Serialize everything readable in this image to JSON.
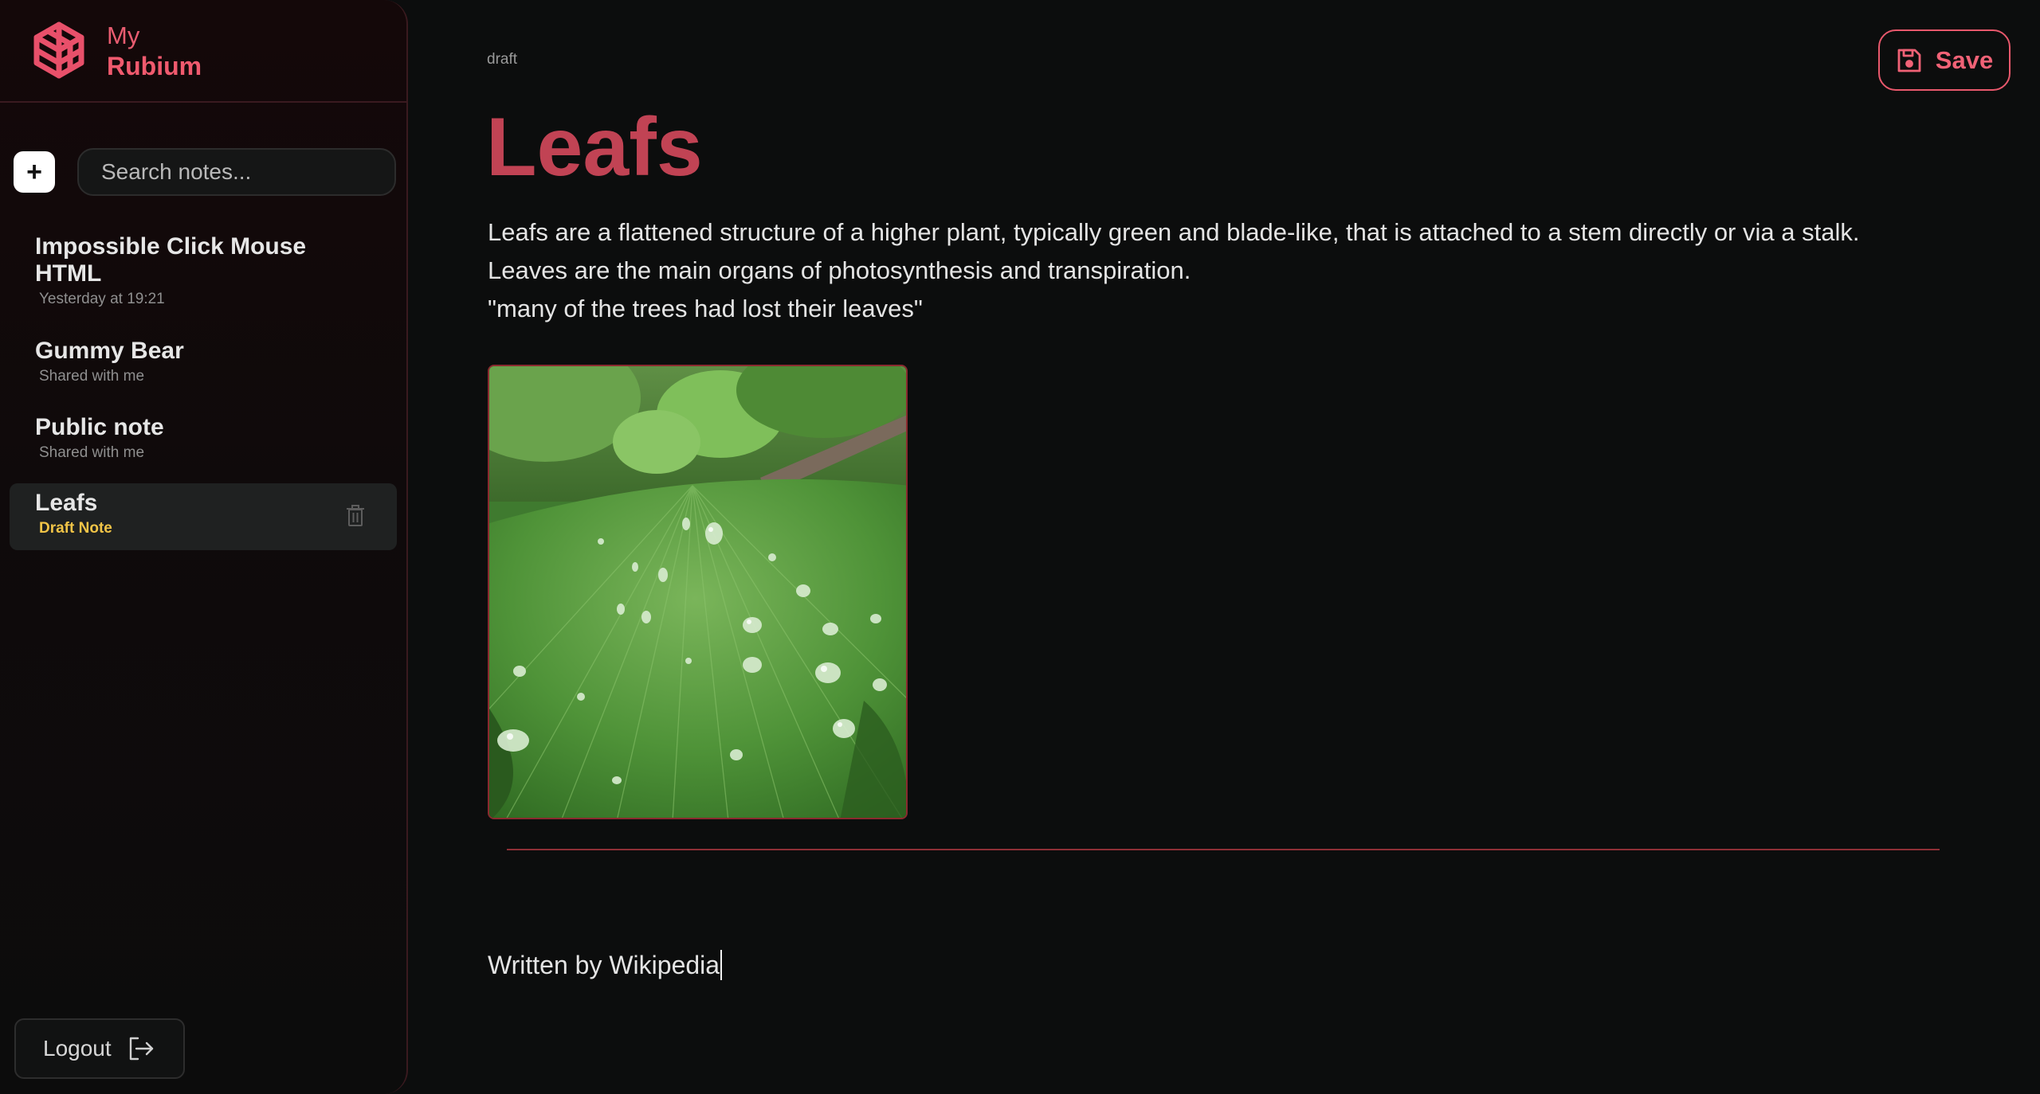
{
  "brand": {
    "line1": "My",
    "line2": "Rubium",
    "logo_icon": "rubium-logo-icon",
    "accent_color": "#f05a6e"
  },
  "sidebar": {
    "add_label": "+",
    "search_placeholder": "Search notes...",
    "search_value": "",
    "notes": [
      {
        "title": "Impossible Click Mouse HTML",
        "subtitle": "Yesterday at 19:21"
      },
      {
        "title": "Gummy Bear",
        "subtitle": "Shared with me"
      },
      {
        "title": "Public note",
        "subtitle": "Shared with me"
      },
      {
        "title": "Leafs",
        "subtitle": "Draft Note",
        "active": true
      }
    ],
    "logout_label": "Logout"
  },
  "editor": {
    "status": "draft",
    "save_label": "Save",
    "title": "Leafs",
    "paragraphs": [
      "Leafs are a flattened structure of a higher plant, typically green and blade-like, that is attached to a stem directly or via a stalk.",
      "Leaves are the main organs of photosynthesis and transpiration.",
      "\"many of the trees had lost their leaves\""
    ],
    "image_subject": "green leaf with water droplets",
    "signature": "Written by Wikipedia"
  },
  "colors": {
    "background": "#0c0d0d",
    "title": "#c14354",
    "draft_badge": "#f1c447",
    "divider": "#8e2f36"
  }
}
